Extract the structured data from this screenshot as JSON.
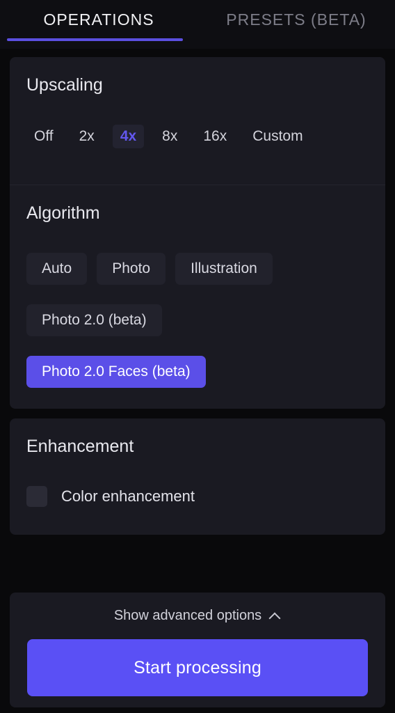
{
  "tabs": [
    {
      "label": "OPERATIONS",
      "active": true
    },
    {
      "label": "PRESETS (BETA)",
      "active": false
    }
  ],
  "upscaling": {
    "title": "Upscaling",
    "options": [
      "Off",
      "2x",
      "4x",
      "8x",
      "16x",
      "Custom"
    ],
    "selected": "4x"
  },
  "algorithm": {
    "title": "Algorithm",
    "options": [
      "Auto",
      "Photo",
      "Illustration",
      "Photo 2.0 (beta)",
      "Photo 2.0 Faces (beta)"
    ],
    "selected": "Photo 2.0 Faces (beta)"
  },
  "enhancement": {
    "title": "Enhancement",
    "color_enhancement_label": "Color enhancement",
    "color_enhancement_checked": false
  },
  "footer": {
    "advanced_label": "Show advanced options",
    "advanced_chevron": "chevron-up-icon",
    "start_label": "Start processing"
  },
  "colors": {
    "accent": "#5a50f5",
    "accent_text": "#6257ee",
    "tab_underline": "#5b4fe0",
    "panel": "#1a1a22",
    "chip": "#22222c",
    "background": "#09090b"
  }
}
